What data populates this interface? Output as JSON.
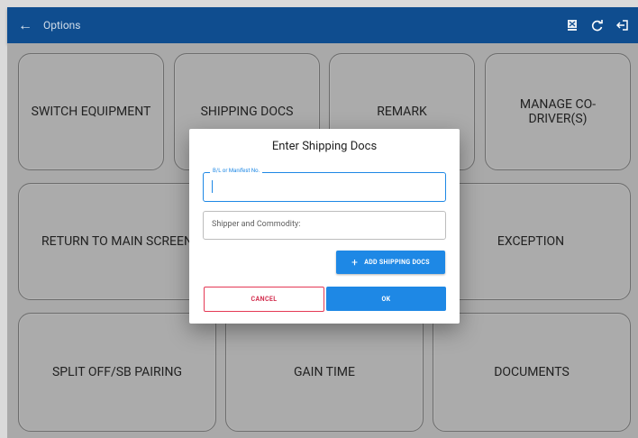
{
  "appbar": {
    "title": "Options",
    "back_icon": "←",
    "actions": [
      "export-icon",
      "refresh-icon",
      "logout-icon"
    ]
  },
  "tiles": {
    "switch_equipment": "SWITCH EQUIPMENT",
    "shipping_docs": "SHIPPING DOCS",
    "remark": "REMARK",
    "manage_codriver": "MANAGE CO-DRIVER(S)",
    "return_main": "RETURN TO MAIN SCREEN",
    "exception": "EXCEPTION",
    "split_off": "SPLIT OFF/SB PAIRING",
    "gain_time": "GAIN TIME",
    "documents": "DOCUMENTS"
  },
  "dialog": {
    "title": "Enter Shipping Docs",
    "bl_label": "B/L or Manifest No.",
    "bl_value": "",
    "shipper_placeholder": "Shipper and Commodity:",
    "add_label": "ADD SHIPPING DOCS",
    "cancel_label": "CANCEL",
    "ok_label": "OK"
  },
  "colors": {
    "appbar": "#0f4d8f",
    "accent": "#1e88e5",
    "cancel": "#e53955"
  }
}
